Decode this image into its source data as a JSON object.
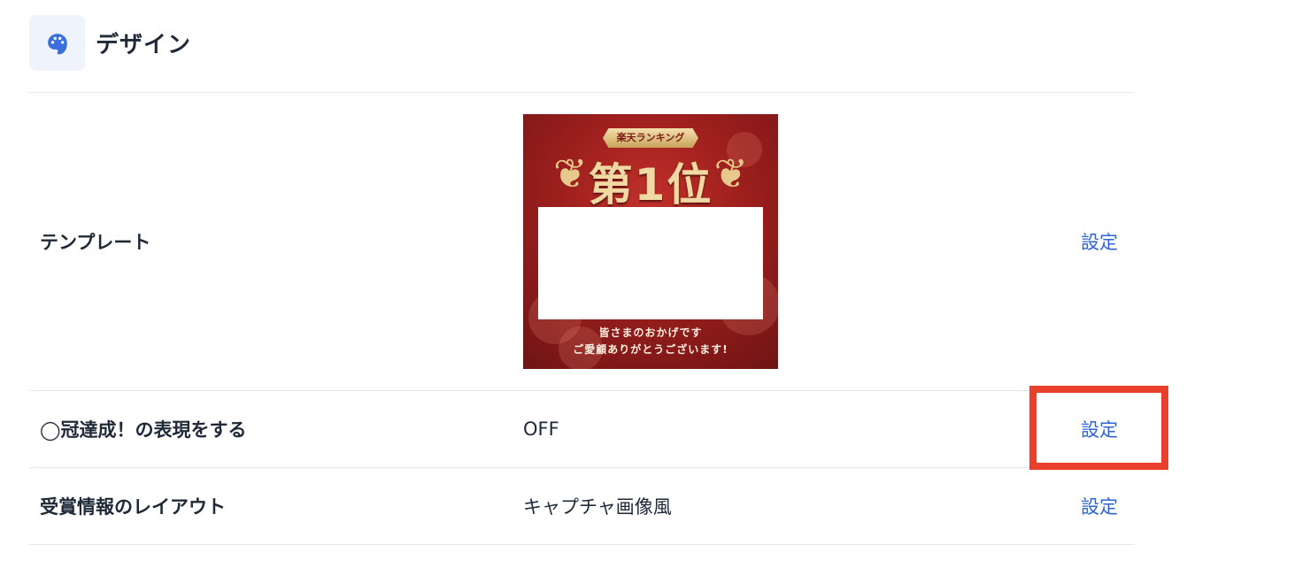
{
  "section": {
    "title": "デザイン",
    "icon": "palette-icon",
    "accent_color": "#3b6fe0"
  },
  "rows": [
    {
      "label": "テンプレート",
      "action": "設定",
      "thumbnail": {
        "ribbon": "楽天ランキング",
        "rank": "第1位",
        "message_line1": "皆さまのおかげです",
        "message_line2": "ご愛顧ありがとうございます!"
      }
    },
    {
      "label": "◯冠達成！の表現をする",
      "value": "OFF",
      "action": "設定"
    },
    {
      "label": "受賞情報のレイアウト",
      "value": "キャプチャ画像風",
      "action": "設定"
    }
  ],
  "colors": {
    "link": "#2f63d8",
    "highlight": "#e8402a",
    "divider": "#e3e7ee"
  }
}
